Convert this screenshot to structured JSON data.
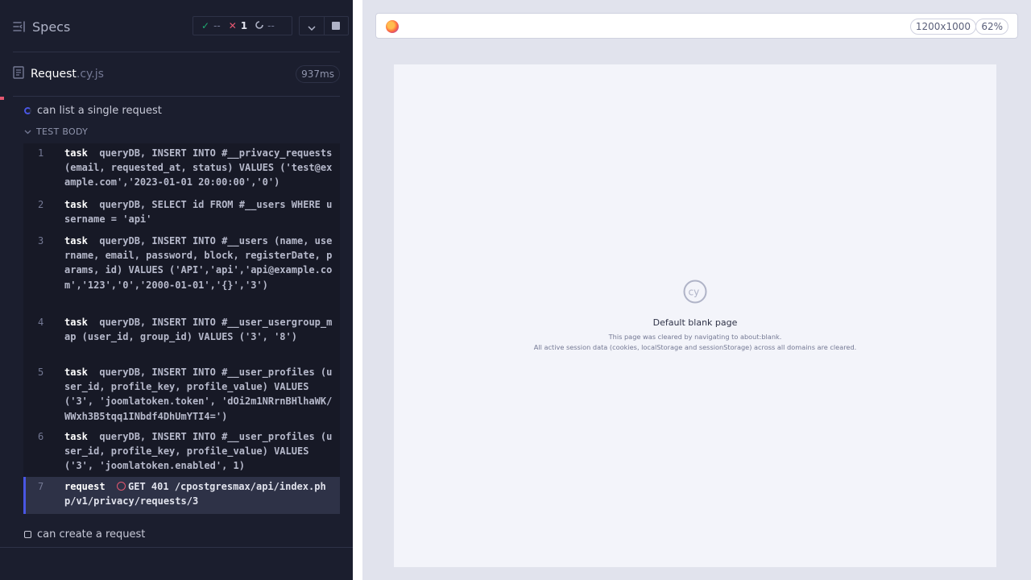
{
  "reporter": {
    "specs_label": "Specs",
    "stats": {
      "passed": "--",
      "failed": "1",
      "pending": "--"
    },
    "spec": {
      "name": "Request",
      "ext": ".cy.js",
      "duration": "937ms"
    },
    "tests": [
      {
        "title": "can list a single request",
        "state": "running"
      },
      {
        "title": "can create a request",
        "state": "pending"
      }
    ],
    "section": "TEST BODY",
    "commands": [
      {
        "n": "1",
        "name": "task",
        "message": "queryDB, INSERT INTO #__privacy_requests (email, requested_at, status) VALUES ('test@example.com','2023-01-01 20:00:00','0')"
      },
      {
        "n": "2",
        "name": "task",
        "message": "queryDB, SELECT id FROM #__users WHERE username = 'api'"
      },
      {
        "n": "3",
        "name": "task",
        "message": "queryDB, INSERT INTO #__users (name, username, email, password, block, registerDate, params, id) VALUES ('API','api','api@example.com','123','0','2000-01-01','{}','3')"
      },
      {
        "n": "4",
        "name": "task",
        "message": "queryDB, INSERT INTO #__user_usergroup_map (user_id, group_id) VALUES ('3', '8')"
      },
      {
        "n": "5",
        "name": "task",
        "message": "queryDB, INSERT INTO #__user_profiles (user_id, profile_key, profile_value) VALUES ('3', 'joomlatoken.token', 'dOi2m1NRrnBHlhaWK/WWxh3B5tqq1INbdf4DhUmYTI4=')"
      },
      {
        "n": "6",
        "name": "task",
        "message": "queryDB, INSERT INTO #__user_profiles (user_id, profile_key, profile_value) VALUES ('3', 'joomlatoken.enabled', 1)"
      },
      {
        "n": "7",
        "name": "request",
        "message": "GET 401 /cpostgresmax/api/index.php/v1/privacy/requests/3"
      }
    ]
  },
  "aut": {
    "viewport": "1200x1000",
    "zoom": "62%",
    "blank_title": "Default blank page",
    "blank_line1": "This page was cleared by navigating to about:blank.",
    "blank_line2": "All active session data (cookies, localStorage and sessionStorage) across all domains are cleared."
  },
  "colors": {
    "reporter_bg": "#1b1e2e",
    "fail": "#e45770",
    "pass": "#1fa971",
    "accent": "#4956e3"
  },
  "icons": [
    "sidebar-toggle-icon",
    "check-icon",
    "x-icon",
    "spinner-icon",
    "chevron-down-icon",
    "stop-icon",
    "document-icon",
    "browser-icon",
    "cypress-logo"
  ]
}
